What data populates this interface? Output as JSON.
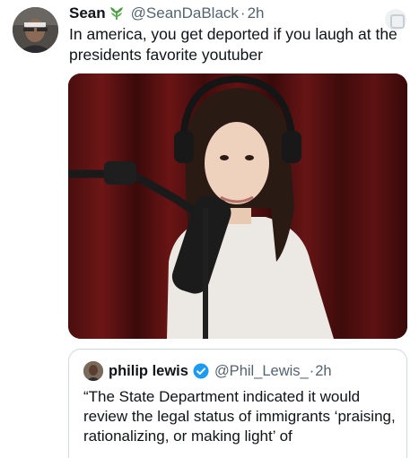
{
  "tweet": {
    "author_name": "Sean",
    "author_badge_icon": "leaf-icon",
    "handle": "@SeanDaBlack",
    "separator": "·",
    "time": "2h",
    "text": "In america, you get deported if you laugh at the presidents favorite youtuber",
    "media_icon": "podcast-photo"
  },
  "quoted_tweet": {
    "author_name": "philip lewis",
    "verified_icon": "verified-badge-icon",
    "handle": "@Phil_Lewis_",
    "separator": "·",
    "time": "2h",
    "text": "“The State Department indicated it would review the legal status of immigrants ‘praising, rationalizing, or making light’ of"
  },
  "colors": {
    "text_primary": "#0f1419",
    "text_secondary": "#536471",
    "verified_blue": "#1d9bf0",
    "border": "#cfd9de"
  }
}
